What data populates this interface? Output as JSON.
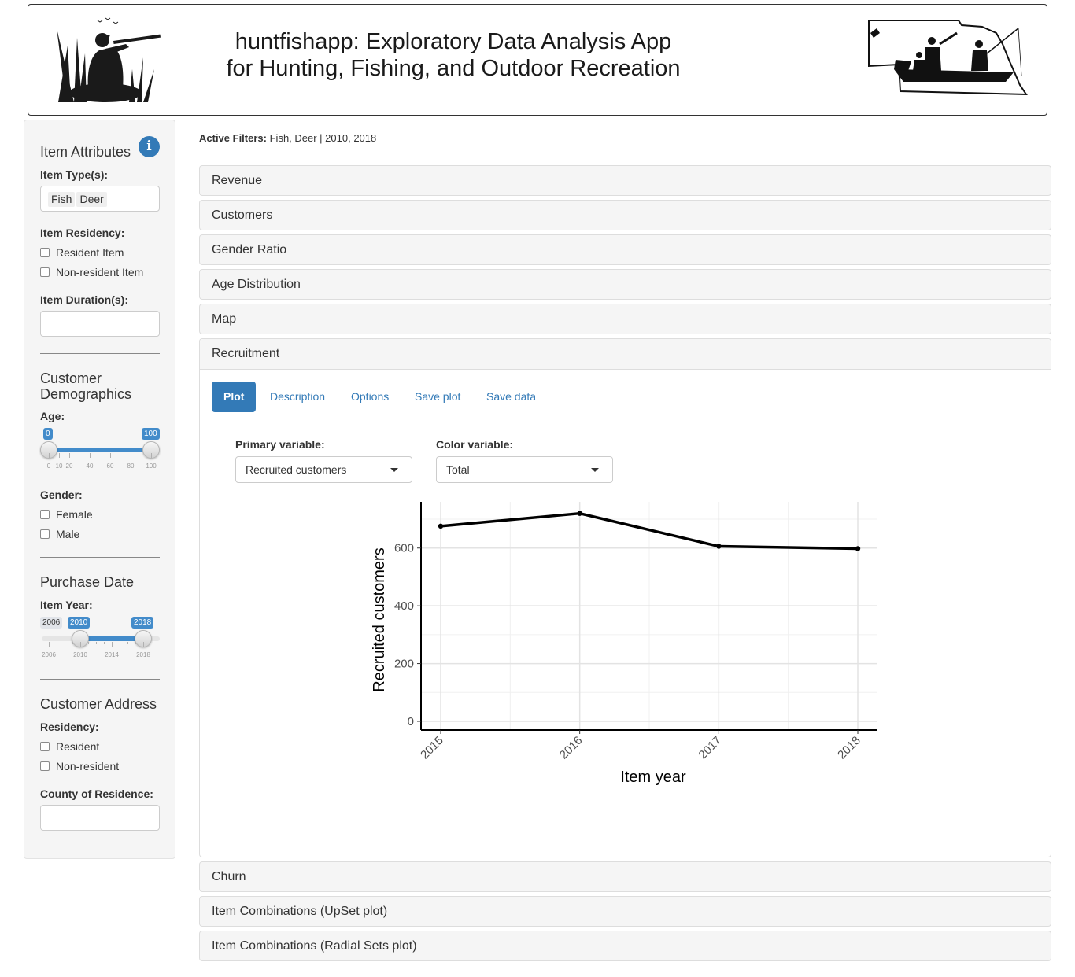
{
  "header": {
    "title_line1": "huntfishapp: Exploratory Data Analysis App",
    "title_line2": "for Hunting, Fishing, and Outdoor Recreation"
  },
  "sidebar": {
    "item_attributes": {
      "heading": "Item Attributes",
      "info_icon": "i",
      "item_types_label": "Item Type(s):",
      "item_types": [
        "Fish",
        "Deer"
      ],
      "residency_label": "Item Residency:",
      "residency_options": [
        "Resident Item",
        "Non-resident Item"
      ],
      "duration_label": "Item Duration(s):",
      "duration_value": ""
    },
    "customer_demographics": {
      "heading_line1": "Customer",
      "heading_line2": "Demographics",
      "age_label": "Age:",
      "age_min": 0,
      "age_max": 100,
      "age_from": "0",
      "age_to": "100",
      "age_ticks": [
        "0",
        "10",
        "20",
        "40",
        "60",
        "80",
        "100"
      ],
      "gender_label": "Gender:",
      "gender_options": [
        "Female",
        "Male"
      ]
    },
    "purchase_date": {
      "heading": "Purchase Date",
      "year_label": "Item Year:",
      "year_min": "2006",
      "year_from": "2010",
      "year_to": "2018",
      "year_ticks": [
        "2006",
        "2010",
        "2014",
        "2018"
      ]
    },
    "customer_address": {
      "heading": "Customer Address",
      "residency_label": "Residency:",
      "residency_options": [
        "Resident",
        "Non-resident"
      ],
      "county_label": "County of Residence:",
      "county_value": ""
    }
  },
  "main": {
    "active_filters_label": "Active Filters:",
    "active_filters_value": "Fish, Deer | 2010, 2018",
    "panels_top": [
      "Revenue",
      "Customers",
      "Gender Ratio",
      "Age Distribution",
      "Map"
    ],
    "open_panel": "Recruitment",
    "panels_bottom": [
      "Churn",
      "Item Combinations (UpSet plot)",
      "Item Combinations (Radial Sets plot)"
    ],
    "tabs": [
      "Plot",
      "Description",
      "Options",
      "Save plot",
      "Save data"
    ],
    "active_tab": "Plot",
    "primary_variable_label": "Primary variable:",
    "primary_variable_value": "Recruited customers",
    "color_variable_label": "Color variable:",
    "color_variable_value": "Total"
  },
  "chart_data": {
    "type": "line",
    "x": [
      "2015",
      "2016",
      "2017",
      "2018"
    ],
    "values": [
      676,
      720,
      606,
      598
    ],
    "xlabel": "Item year",
    "ylabel": "Recruited customers",
    "yticks": [
      0,
      200,
      400,
      600
    ],
    "ylim": [
      -30,
      760
    ],
    "grid": true,
    "color": "#000000"
  }
}
